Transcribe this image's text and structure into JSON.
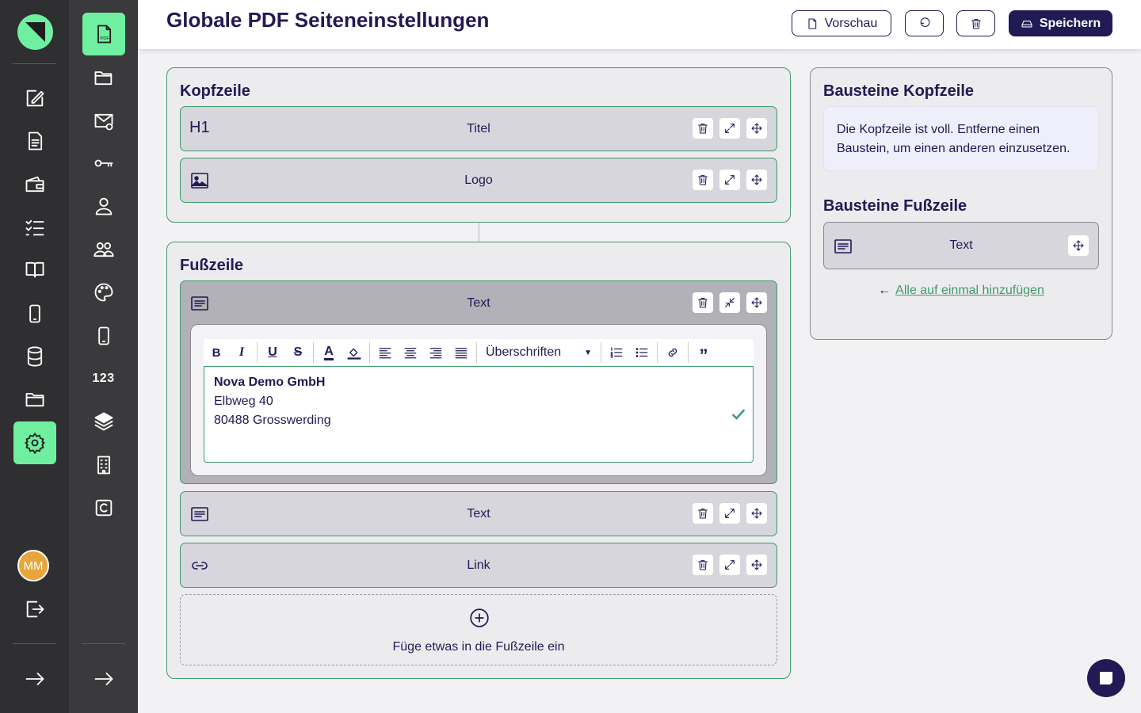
{
  "header": {
    "title": "Globale PDF Seiteneinstellungen",
    "preview_label": "Vorschau",
    "save_label": "Speichern"
  },
  "rail": {
    "avatar_initials": "MM",
    "numbers_label": "123"
  },
  "header_section": {
    "title": "Kopfzeile",
    "blocks": [
      {
        "tag": "H1",
        "label": "Titel",
        "icon": "heading-icon"
      },
      {
        "label": "Logo",
        "icon": "image-icon"
      }
    ]
  },
  "footer_section": {
    "title": "Fußzeile",
    "expanded_block": {
      "label": "Text",
      "toolbar": {
        "headings_label": "Überschriften"
      },
      "content": {
        "line1": "Nova Demo GmbH",
        "line2": "Elbweg 40",
        "line3": "80488 Grosswerding"
      }
    },
    "blocks": [
      {
        "label": "Text",
        "icon": "text-icon"
      },
      {
        "label": "Link",
        "icon": "link-icon"
      }
    ],
    "add_label": "Füge etwas in die Fußzeile ein"
  },
  "sidebar_panel": {
    "header_blocks_title": "Bausteine Kopfzeile",
    "header_full_note": "Die Kopfzeile ist voll. Entferne einen Baustein, um einen anderen einzusetzen.",
    "footer_blocks_title": "Bausteine Fußzeile",
    "footer_block_label": "Text",
    "add_all_label": "Alle auf einmal hinzufügen"
  },
  "colors": {
    "accent_green": "#6ef0a0",
    "primary": "#211a55",
    "border_green": "#3f9a6b"
  }
}
